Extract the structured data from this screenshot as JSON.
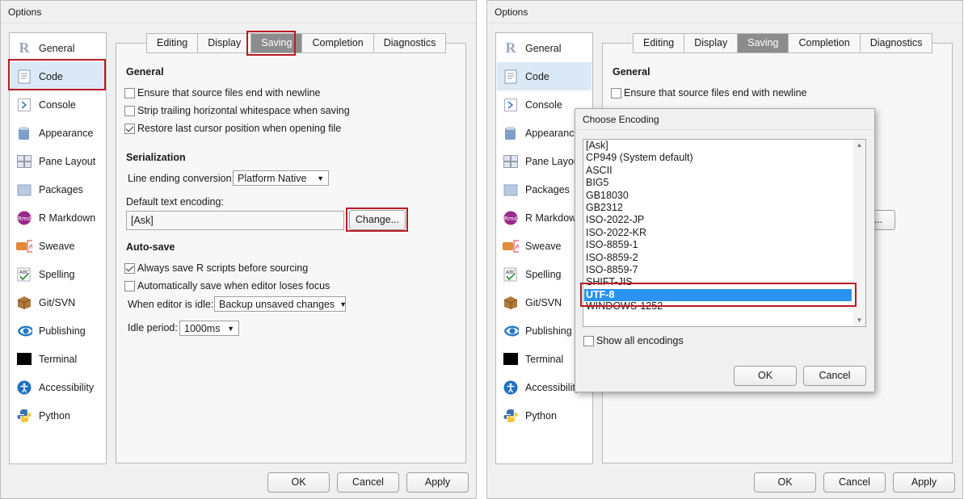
{
  "left_window": {
    "title": "Options",
    "sidebar": [
      {
        "label": "General",
        "icon": "r-logo-icon"
      },
      {
        "label": "Code",
        "icon": "code-doc-icon"
      },
      {
        "label": "Console",
        "icon": "console-prompt-icon"
      },
      {
        "label": "Appearance",
        "icon": "appearance-icon"
      },
      {
        "label": "Pane Layout",
        "icon": "pane-layout-icon"
      },
      {
        "label": "Packages",
        "icon": "packages-icon"
      },
      {
        "label": "R Markdown",
        "icon": "rmd-icon"
      },
      {
        "label": "Sweave",
        "icon": "sweave-icon"
      },
      {
        "label": "Spelling",
        "icon": "spelling-icon"
      },
      {
        "label": "Git/SVN",
        "icon": "git-box-icon"
      },
      {
        "label": "Publishing",
        "icon": "publishing-icon"
      },
      {
        "label": "Terminal",
        "icon": "terminal-icon"
      },
      {
        "label": "Accessibility",
        "icon": "accessibility-icon"
      },
      {
        "label": "Python",
        "icon": "python-icon"
      }
    ],
    "tabs": [
      "Editing",
      "Display",
      "Saving",
      "Completion",
      "Diagnostics"
    ],
    "active_tab": "Saving",
    "sections": {
      "general": "General",
      "serialization": "Serialization",
      "autosave": "Auto-save"
    },
    "checks": {
      "newline": {
        "label": "Ensure that source files end with newline",
        "checked": false
      },
      "strip": {
        "label": "Strip trailing horizontal whitespace when saving",
        "checked": false
      },
      "restore": {
        "label": "Restore last cursor position when opening file",
        "checked": true
      },
      "always_save": {
        "label": "Always save R scripts before sourcing",
        "checked": true
      },
      "auto_save": {
        "label": "Automatically save when editor loses focus",
        "checked": false
      }
    },
    "line_ending_label": "Line ending conversion:",
    "line_ending_value": "Platform Native",
    "encoding_label": "Default text encoding:",
    "encoding_value": "[Ask]",
    "change_button": "Change...",
    "idle_label": "When editor is idle:",
    "idle_value": "Backup unsaved changes",
    "idle_period_label": "Idle period:",
    "idle_period_value": "1000ms",
    "buttons": {
      "ok": "OK",
      "cancel": "Cancel",
      "apply": "Apply"
    }
  },
  "right_window": {
    "title": "Options",
    "tabs": [
      "Editing",
      "Display",
      "Saving",
      "Completion",
      "Diagnostics"
    ],
    "general": "General",
    "newline": "Ensure that source files end with newline",
    "buttons": {
      "ok": "OK",
      "cancel": "Cancel",
      "apply": "Apply"
    }
  },
  "dialog": {
    "title": "Choose Encoding",
    "encodings": [
      "[Ask]",
      "CP949 (System default)",
      "ASCII",
      "BIG5",
      "GB18030",
      "GB2312",
      "ISO-2022-JP",
      "ISO-2022-KR",
      "ISO-8859-1",
      "ISO-8859-2",
      "ISO-8859-7",
      "SHIFT-JIS",
      "UTF-8",
      "WINDOWS-1252"
    ],
    "selected": "UTF-8",
    "show_all_label": "Show all encodings",
    "ok": "OK",
    "cancel": "Cancel"
  },
  "colors": {
    "highlight": "#b81c24",
    "selection": "#2a93f0",
    "sidebar_selected": "#dbe9f6"
  }
}
